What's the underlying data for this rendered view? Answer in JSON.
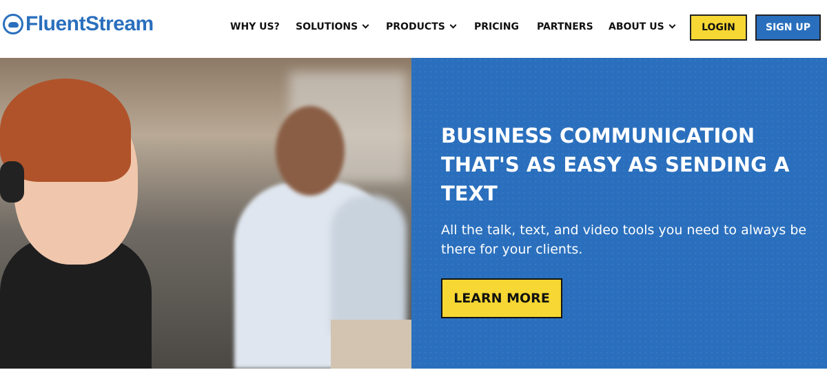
{
  "header": {
    "logo_text": "FluentStream",
    "nav": [
      {
        "label": "WHY US?",
        "has_dropdown": false
      },
      {
        "label": "SOLUTIONS",
        "has_dropdown": true
      },
      {
        "label": "PRODUCTS",
        "has_dropdown": true
      },
      {
        "label": "PRICING",
        "has_dropdown": false
      },
      {
        "label": "PARTNERS",
        "has_dropdown": false
      },
      {
        "label": "ABOUT US",
        "has_dropdown": true
      }
    ],
    "login_label": "LOGIN",
    "signup_label": "SIGN UP"
  },
  "hero": {
    "title": "BUSINESS COMMUNICATION THAT'S AS EASY AS SENDING A TEXT",
    "subtitle": "All the talk, text, and video tools you need to always be there for your clients.",
    "cta_label": "LEARN MORE"
  },
  "colors": {
    "brand_blue": "#2a6fbd",
    "accent_yellow": "#f6d733"
  }
}
